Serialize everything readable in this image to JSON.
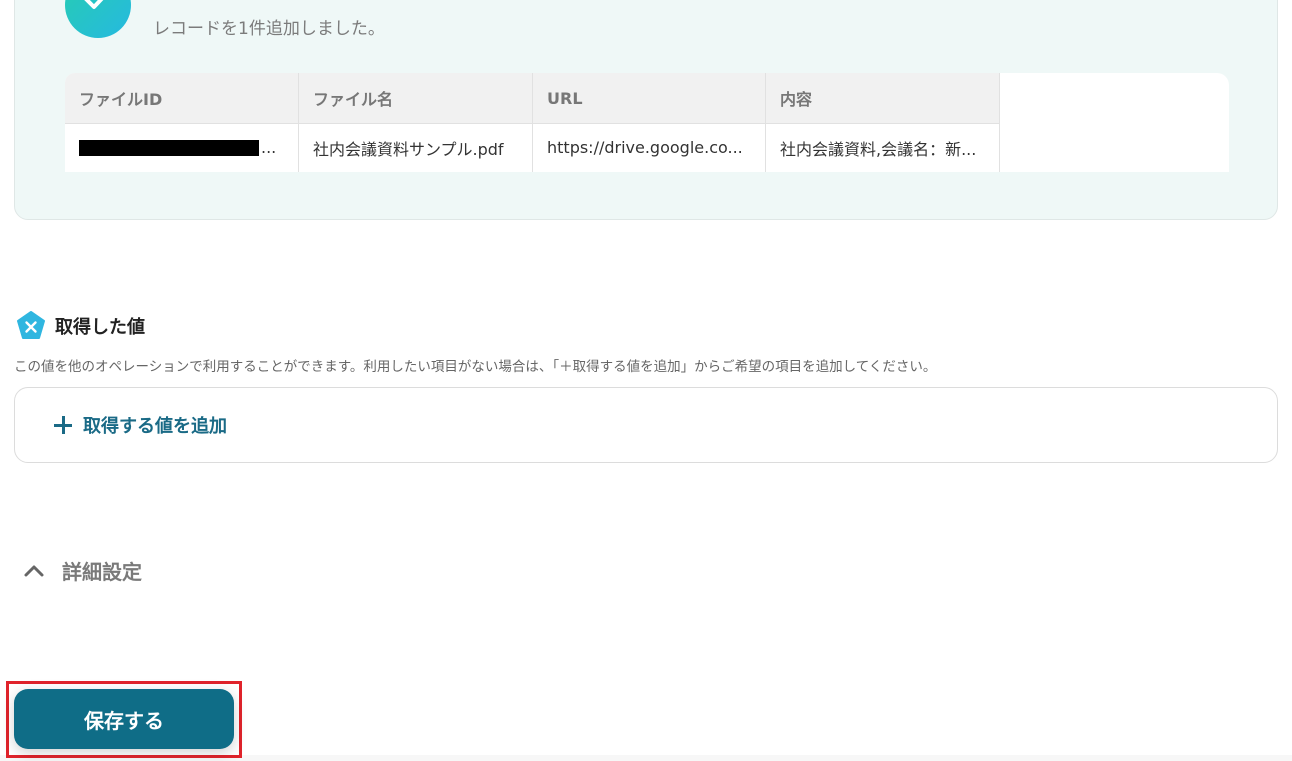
{
  "success": {
    "message": "レコードを1件追加しました。"
  },
  "table": {
    "headers": [
      "ファイルID",
      "ファイル名",
      "URL",
      "内容"
    ],
    "row": {
      "file_id_suffix": "...",
      "file_name": "社内会議資料サンプル.pdf",
      "url": "https://drive.google.co...",
      "content": "社内会議資料,会議名：新..."
    }
  },
  "acquired": {
    "title": "取得した値",
    "description": "この値を他のオペレーションで利用することができます。利用したい項目がない場合は、「＋取得する値を追加」からご希望の項目を追加してください。",
    "add_label": "取得する値を追加"
  },
  "advanced": {
    "label": "詳細設定"
  },
  "footer": {
    "save_label": "保存する"
  },
  "colors": {
    "primary": "#0f6d87",
    "accent_text": "#1a6a86",
    "panel_bg": "#eff8f7",
    "highlight": "#e0232b"
  }
}
